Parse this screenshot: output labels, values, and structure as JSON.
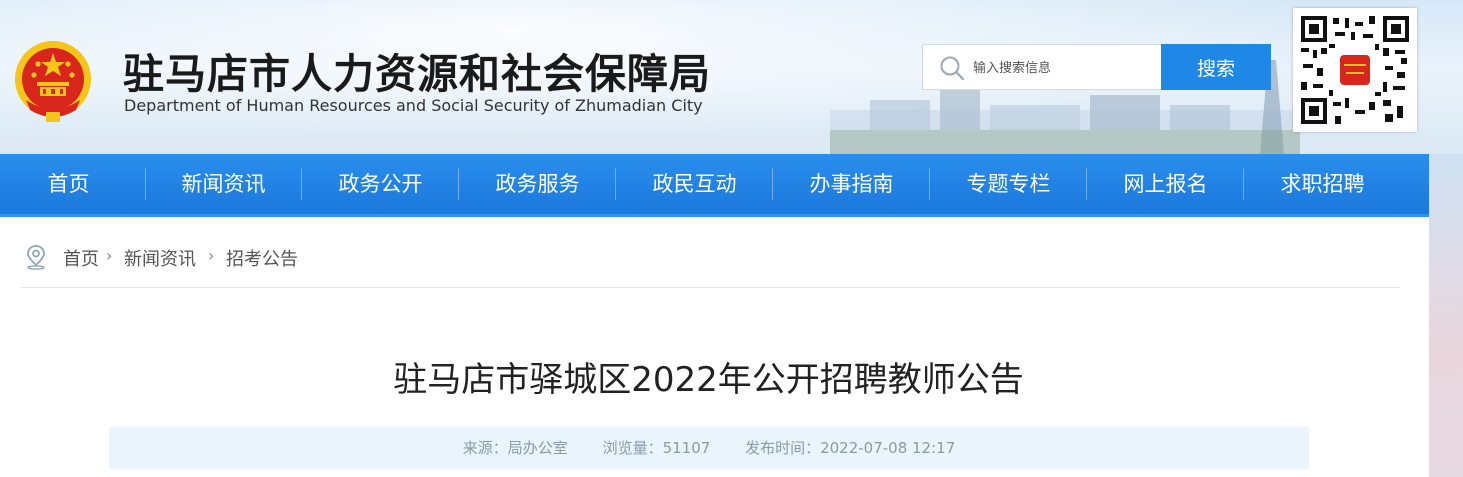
{
  "header": {
    "title": "驻马店市人力资源和社会保障局",
    "subtitle": "Department of Human Resources and Social Security of Zhumadian City",
    "emblem_icon": "national-emblem-icon",
    "qr_icon": "qr-code-icon"
  },
  "search": {
    "placeholder": "输入搜索信息",
    "button_label": "搜索",
    "icon": "search-icon"
  },
  "nav": {
    "items": [
      {
        "label": "首页"
      },
      {
        "label": "新闻资讯"
      },
      {
        "label": "政务公开"
      },
      {
        "label": "政务服务"
      },
      {
        "label": "政民互动"
      },
      {
        "label": "办事指南"
      },
      {
        "label": "专题专栏"
      },
      {
        "label": "网上报名"
      },
      {
        "label": "求职招聘"
      }
    ]
  },
  "breadcrumb": {
    "icon": "location-pin-icon",
    "separator": "›",
    "items": [
      "首页",
      "新闻资讯",
      "招考公告"
    ]
  },
  "article": {
    "title": "驻马店市驿城区2022年公开招聘教师公告",
    "meta": {
      "source": "来源：局办公室",
      "views": "浏览量：51107",
      "published": "发布时间：2022-07-08 12:17"
    }
  },
  "colors": {
    "nav_blue": "#1f87e6",
    "title_text": "#1a1a1a",
    "meta_bg": "#eaf4fd",
    "emblem_red": "#d9261c",
    "emblem_gold": "#f5c518"
  }
}
